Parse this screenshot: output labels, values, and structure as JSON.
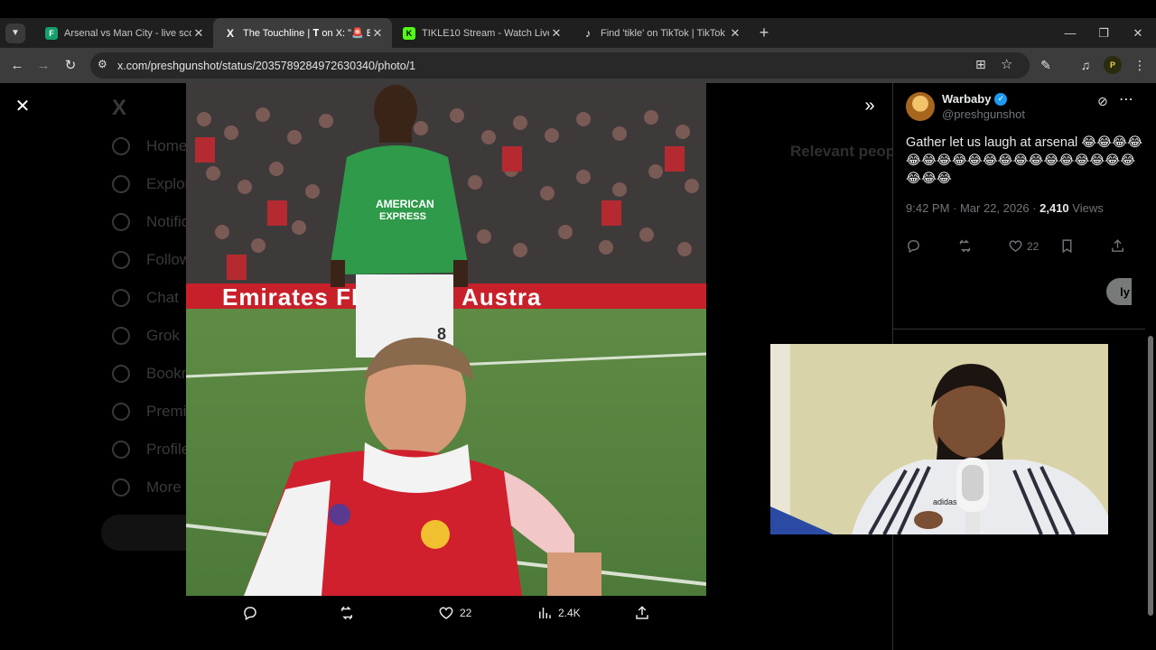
{
  "browser": {
    "tabs": [
      {
        "title": "Arsenal vs Man City - live score",
        "favicon_color": "#14a06b",
        "favicon_letter": "F",
        "active": false
      },
      {
        "title": "The Touchline | 𝐓 on X: \"🚨 BRE",
        "favicon_color": "#000000",
        "favicon_letter": "X",
        "active": true
      },
      {
        "title": "TIKLE10 Stream - Watch Live on",
        "favicon_color": "#53fc18",
        "favicon_letter": "K",
        "active": false
      },
      {
        "title": "Find 'tikle' on TikTok | TikTok Se",
        "favicon_color": "#000000",
        "favicon_letter": "♪",
        "active": false
      }
    ],
    "url": "x.com/preshgunshot/status/2035789284972630340/photo/1"
  },
  "background_nav": [
    "Home",
    "Explore",
    "Notifications",
    "Follow",
    "Chat",
    "Grok",
    "Bookmarks",
    "Premium",
    "Profile",
    "More"
  ],
  "background_right_heading": "Relevant people",
  "media": {
    "actions": {
      "likes": "22",
      "views": "2.4K"
    }
  },
  "tweet": {
    "display_name": "Warbaby",
    "handle": "@preshgunshot",
    "text": "Gather let us laugh at arsenal 😂😂😂😂😂😂😂😂😂😂😂😂😂😂😂😂😂😂😂😂😂😂",
    "time": "9:42 PM · Mar 22, 2026 · ",
    "views_count": "2,410",
    "views_label": " Views",
    "likes": "22",
    "reply_button_peek": "ly"
  },
  "colors": {
    "accent": "#1d9bf0",
    "arsenal_red": "#d0202e",
    "brighton_green": "#2e9a4a"
  }
}
